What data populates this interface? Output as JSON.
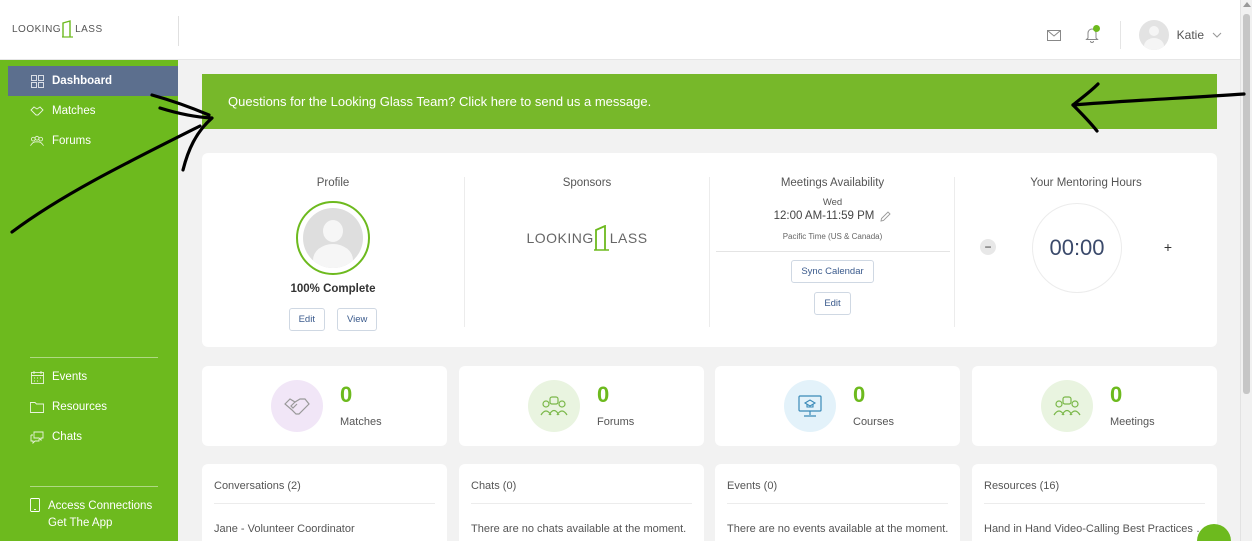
{
  "header": {
    "logo_left": "LOOKING",
    "logo_right": "LASS",
    "user_name": "Katie",
    "icons": [
      "mail-icon",
      "bell-icon",
      "chevron-down-icon"
    ],
    "notification_dot_color": "#6dba1e"
  },
  "sidebar": {
    "color": "#6dba1e",
    "active_color": "#5c6f8e",
    "top_items": [
      {
        "label": "Dashboard",
        "icon": "grid-icon",
        "active": true
      },
      {
        "label": "Matches",
        "icon": "handshake-icon"
      },
      {
        "label": "Forums",
        "icon": "people-icon"
      }
    ],
    "mid_items": [
      {
        "label": "Events",
        "icon": "calendar-icon"
      },
      {
        "label": "Resources",
        "icon": "folder-icon"
      },
      {
        "label": "Chats",
        "icon": "chat-icon"
      }
    ],
    "bottom": {
      "line1": "Access Connections",
      "line2": "Get The App",
      "icon": "phone-icon"
    }
  },
  "banner": {
    "text": "Questions for the Looking Glass Team? Click here to send us a message.",
    "color": "#77b82a"
  },
  "profile": {
    "title": "Profile",
    "complete": "100% Complete",
    "edit_label": "Edit",
    "view_label": "View"
  },
  "sponsors": {
    "title": "Sponsors",
    "logo_left": "LOOKING",
    "logo_right": "LASS"
  },
  "meetings": {
    "title": "Meetings Availability",
    "day": "Wed",
    "time": "12:00 AM-11:59 PM",
    "timezone": "Pacific Time (US & Canada)",
    "sync_label": "Sync Calendar",
    "edit_label": "Edit"
  },
  "hours": {
    "title": "Your Mentoring Hours",
    "value": "00:00",
    "minus": "−",
    "plus": "+"
  },
  "stats": [
    {
      "num": "0",
      "label": "Matches",
      "icon": "handshake-icon",
      "bg": "#f1e6f7"
    },
    {
      "num": "0",
      "label": "Forums",
      "icon": "people-icon",
      "bg": "#e9f4e0"
    },
    {
      "num": "0",
      "label": "Courses",
      "icon": "monitor-graduation-icon",
      "bg": "#e3f2fa"
    },
    {
      "num": "0",
      "label": "Meetings",
      "icon": "people-icon",
      "bg": "#e9f4e0"
    }
  ],
  "lists": [
    {
      "title": "Conversations (2)",
      "text": "Jane - Volunteer Coordinator"
    },
    {
      "title": "Chats (0)",
      "text": "There are no chats available at the moment."
    },
    {
      "title": "Events (0)",
      "text": "There are no events available at the moment."
    },
    {
      "title": "Resources (16)",
      "text": "Hand in Hand Video-Calling Best Practices G..."
    }
  ]
}
